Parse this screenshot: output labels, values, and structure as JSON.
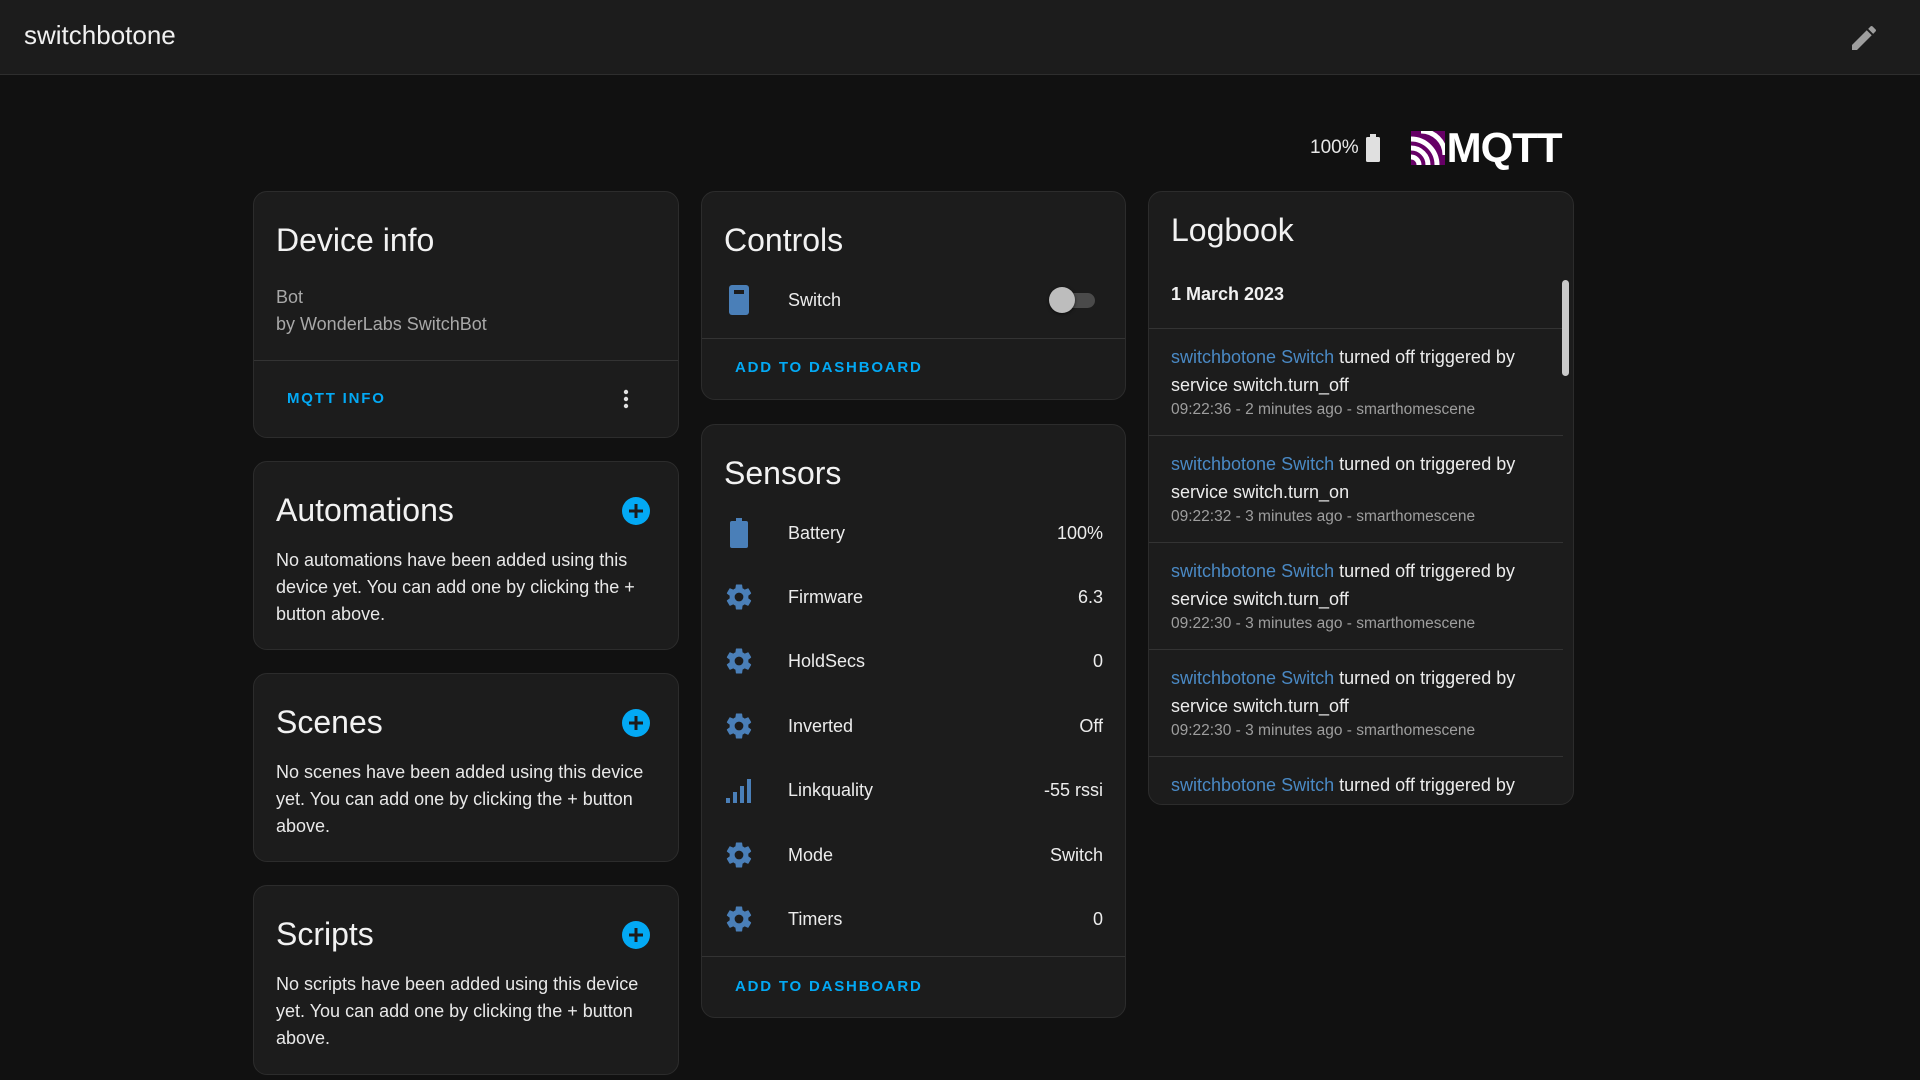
{
  "topbar": {
    "title": "switchbotone",
    "edit_icon": "pencil-icon"
  },
  "header": {
    "battery_text": "100%",
    "battery_icon": "battery-icon",
    "integration_logo": "MQTT"
  },
  "colors": {
    "accent": "#03a9f4",
    "icon": "#4a7fb8",
    "entity_link": "#4a89c4",
    "mqtt_purple": "#660066",
    "background": "#111111",
    "card": "#1c1c1c"
  },
  "device_info": {
    "title": "Device info",
    "model": "Bot",
    "manufacturer": "by WonderLabs SwitchBot",
    "mqtt_info_label": "MQTT INFO",
    "more_icon": "dots-vertical-icon"
  },
  "automations": {
    "title": "Automations",
    "empty_text": "No automations have been added using this device yet. You can add one by clicking the + button above."
  },
  "scenes": {
    "title": "Scenes",
    "empty_text": "No scenes have been added using this device yet. You can add one by clicking the + button above."
  },
  "scripts": {
    "title": "Scripts",
    "empty_text": "No scripts have been added using this device yet. You can add one by clicking the + button above."
  },
  "controls": {
    "title": "Controls",
    "items": [
      {
        "label": "Switch",
        "icon": "switch-icon",
        "state": "off"
      }
    ],
    "add_to_dashboard": "ADD TO DASHBOARD"
  },
  "sensors": {
    "title": "Sensors",
    "items": [
      {
        "label": "Battery",
        "value": "100%",
        "icon": "battery-icon"
      },
      {
        "label": "Firmware",
        "value": "6.3",
        "icon": "gear-icon"
      },
      {
        "label": "HoldSecs",
        "value": "0",
        "icon": "gear-icon"
      },
      {
        "label": "Inverted",
        "value": "Off",
        "icon": "gear-icon"
      },
      {
        "label": "Linkquality",
        "value": "-55 rssi",
        "icon": "signal-icon"
      },
      {
        "label": "Mode",
        "value": "Switch",
        "icon": "gear-icon"
      },
      {
        "label": "Timers",
        "value": "0",
        "icon": "gear-icon"
      }
    ],
    "add_to_dashboard": "ADD TO DASHBOARD"
  },
  "logbook": {
    "title": "Logbook",
    "date": "1 March 2023",
    "entries": [
      {
        "entity": "switchbotone Switch",
        "message": " turned off triggered by service switch.turn_off",
        "meta": "09:22:36 - 2 minutes ago - smarthomescene"
      },
      {
        "entity": "switchbotone Switch",
        "message": " turned on triggered by service switch.turn_on",
        "meta": "09:22:32 - 3 minutes ago - smarthomescene"
      },
      {
        "entity": "switchbotone Switch",
        "message": " turned off triggered by service switch.turn_off",
        "meta": "09:22:30 - 3 minutes ago - smarthomescene"
      },
      {
        "entity": "switchbotone Switch",
        "message": " turned on triggered by service switch.turn_off",
        "meta": "09:22:30 - 3 minutes ago - smarthomescene"
      },
      {
        "entity": "switchbotone Switch",
        "message": " turned off triggered by service switch.turn_off",
        "meta": ""
      }
    ]
  }
}
